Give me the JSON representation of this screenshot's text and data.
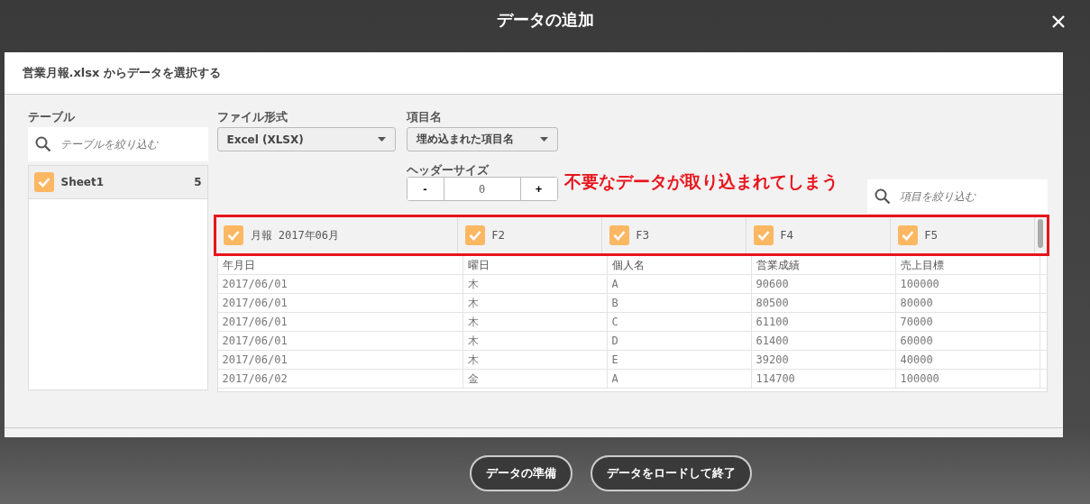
{
  "window": {
    "title": "データの追加"
  },
  "dialog": {
    "title": "営業月報.xlsx からデータを選択する"
  },
  "tables_panel": {
    "label": "テーブル",
    "search": {
      "placeholder": "テーブルを絞り込む"
    },
    "items": [
      {
        "name": "Sheet1",
        "count": "5",
        "checked": true,
        "selected": true
      }
    ]
  },
  "file_format": {
    "label": "ファイル形式",
    "value": "Excel (XLSX)"
  },
  "field_names": {
    "label": "項目名",
    "value": "埋め込まれた項目名"
  },
  "header_size": {
    "label": "ヘッダーサイズ",
    "minus": "-",
    "value": "0",
    "plus": "+"
  },
  "annotation": "不要なデータが取り込まれてしまう",
  "field_search": {
    "placeholder": "項目を絞り込む"
  },
  "table": {
    "columns": [
      {
        "label": "月報 2017年06月",
        "checked": true
      },
      {
        "label": "F2",
        "checked": true
      },
      {
        "label": "F3",
        "checked": true
      },
      {
        "label": "F4",
        "checked": true
      },
      {
        "label": "F5",
        "checked": true
      }
    ],
    "rows": [
      [
        "年月日",
        "曜日",
        "個人名",
        "営業成績",
        "売上目標"
      ],
      [
        "2017/06/01",
        "木",
        "A",
        "90600",
        "100000"
      ],
      [
        "2017/06/01",
        "木",
        "B",
        "80500",
        "80000"
      ],
      [
        "2017/06/01",
        "木",
        "C",
        "61100",
        "70000"
      ],
      [
        "2017/06/01",
        "木",
        "D",
        "61400",
        "60000"
      ],
      [
        "2017/06/01",
        "木",
        "E",
        "39200",
        "40000"
      ],
      [
        "2017/06/02",
        "金",
        "A",
        "114700",
        "100000"
      ]
    ]
  },
  "footer_buttons": [
    "データの準備",
    "データをロードして終了"
  ]
}
